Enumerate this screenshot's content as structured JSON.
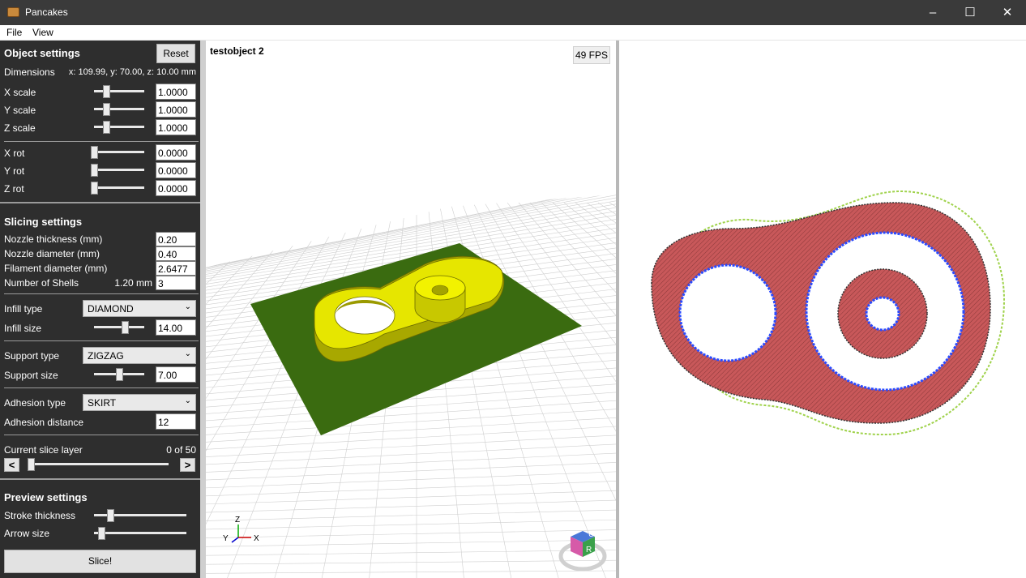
{
  "window": {
    "title": "Pancakes",
    "minimize": "–",
    "maximize": "☐",
    "close": "✕"
  },
  "menu": [
    "File",
    "View"
  ],
  "object_settings": {
    "title": "Object settings",
    "reset": "Reset",
    "dimensions_label": "Dimensions",
    "dimensions_value": "x: 109.99, y: 70.00, z: 10.00 mm",
    "x_scale": {
      "label": "X scale",
      "value": "1.0000",
      "slider": 0.2
    },
    "y_scale": {
      "label": "Y scale",
      "value": "1.0000",
      "slider": 0.2
    },
    "z_scale": {
      "label": "Z scale",
      "value": "1.0000",
      "slider": 0.2
    },
    "x_rot": {
      "label": "X rot",
      "value": "0.0000",
      "slider": 0
    },
    "y_rot": {
      "label": "Y rot",
      "value": "0.0000",
      "slider": 0
    },
    "z_rot": {
      "label": "Z rot",
      "value": "0.0000",
      "slider": 0
    }
  },
  "slicing_settings": {
    "title": "Slicing settings",
    "nozzle_thickness": {
      "label": "Nozzle thickness (mm)",
      "value": "0.20"
    },
    "nozzle_diameter": {
      "label": "Nozzle diameter (mm)",
      "value": "0.40"
    },
    "filament_diameter": {
      "label": "Filament diameter (mm)",
      "value": "2.6477"
    },
    "shells": {
      "label": "Number of Shells",
      "info": "1.20 mm",
      "value": "3"
    },
    "infill_type": {
      "label": "Infill type",
      "value": "DIAMOND"
    },
    "infill_size": {
      "label": "Infill size",
      "value": "14.00",
      "slider": 0.65
    },
    "support_type": {
      "label": "Support type",
      "value": "ZIGZAG"
    },
    "support_size": {
      "label": "Support size",
      "value": "7.00",
      "slider": 0.5
    },
    "adhesion_type": {
      "label": "Adhesion type",
      "value": "SKIRT"
    },
    "adhesion_distance": {
      "label": "Adhesion distance",
      "value": "12"
    },
    "slice_layer": {
      "label": "Current slice layer",
      "value": "0 of 50",
      "prev": "<",
      "next": ">",
      "slider": 0
    }
  },
  "preview_settings": {
    "title": "Preview settings",
    "stroke_thickness": {
      "label": "Stroke thickness",
      "slider": 0.15
    },
    "arrow_size": {
      "label": "Arrow size",
      "slider": 0.05
    }
  },
  "slice_button": "Slice!",
  "viewport3d": {
    "object_name": "testobject 2",
    "fps": "49 FPS",
    "axis_x": "X",
    "axis_z": "Z",
    "cube_u": "U",
    "cube_r": "R",
    "plate_color": "#3a6b10",
    "object_color": "#e0e000"
  },
  "viewport2d": {
    "fill_color": "#c8585a",
    "skirt_color": "#9fd24b",
    "inner_wall_color": "#2a4bff"
  }
}
